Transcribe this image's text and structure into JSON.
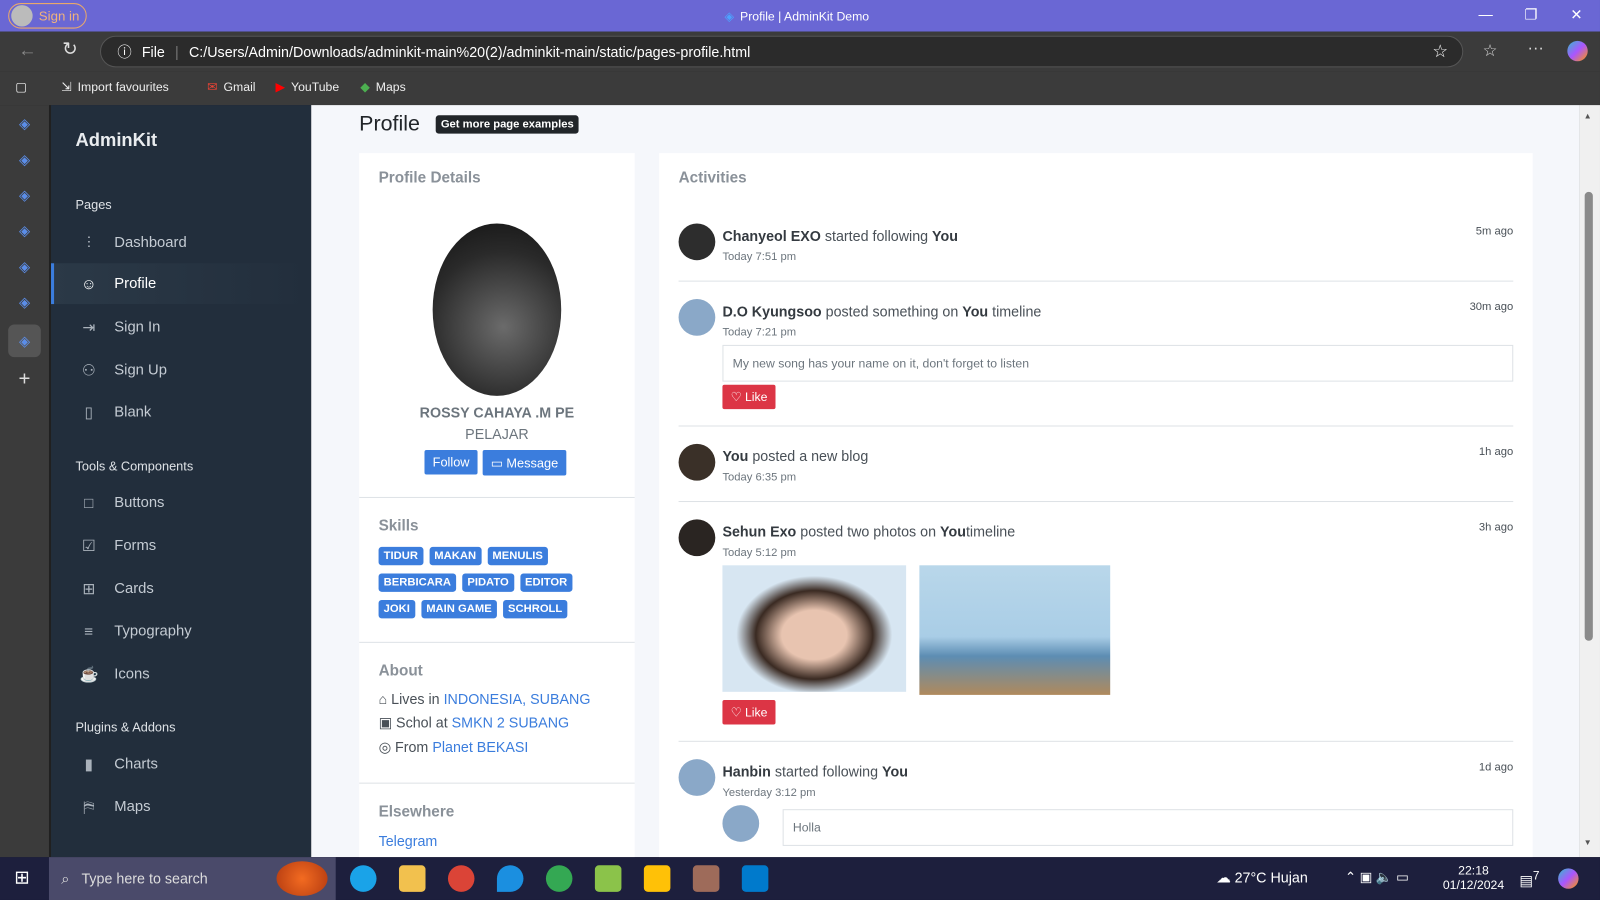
{
  "browser": {
    "signin": "Sign in",
    "title": "Profile | AdminKit Demo",
    "file_label": "File",
    "url": "C:/Users/Admin/Downloads/adminkit-main%20(2)/adminkit-main/static/pages-profile.html",
    "bookmarks": [
      "Import favourites",
      "Gmail",
      "YouTube",
      "Maps"
    ]
  },
  "sidebar": {
    "brand": "AdminKit",
    "sections": [
      "Pages",
      "Tools & Components",
      "Plugins & Addons"
    ],
    "items": [
      {
        "label": "Dashboard",
        "icon": "sliders-icon"
      },
      {
        "label": "Profile",
        "icon": "user-icon"
      },
      {
        "label": "Sign In",
        "icon": "log-in-icon"
      },
      {
        "label": "Sign Up",
        "icon": "user-plus-icon"
      },
      {
        "label": "Blank",
        "icon": "book-icon"
      },
      {
        "label": "Buttons",
        "icon": "square-icon"
      },
      {
        "label": "Forms",
        "icon": "check-square-icon"
      },
      {
        "label": "Cards",
        "icon": "grid-icon"
      },
      {
        "label": "Typography",
        "icon": "align-left-icon"
      },
      {
        "label": "Icons",
        "icon": "coffee-icon"
      },
      {
        "label": "Charts",
        "icon": "bar-chart-icon"
      },
      {
        "label": "Maps",
        "icon": "map-icon"
      }
    ]
  },
  "page": {
    "title": "Profile",
    "badge": "Get more page examples"
  },
  "profile": {
    "card_title": "Profile Details",
    "name": "ROSSY CAHAYA .M PE",
    "role": "PELAJAR",
    "follow": "Follow",
    "message": "Message",
    "skills_title": "Skills",
    "skills": [
      "TIDUR",
      "MAKAN",
      "MENULIS",
      "BERBICARA",
      "PIDATO",
      "EDITOR",
      "JOKI",
      "MAIN GAME",
      "SCHROLL"
    ],
    "about_title": "About",
    "about": [
      {
        "prefix": "Lives in",
        "link": "INDONESIA, SUBANG"
      },
      {
        "prefix": "Schol at",
        "link": "SMKN 2 SUBANG"
      },
      {
        "prefix": "From",
        "link": "Planet BEKASI"
      }
    ],
    "elsewhere_title": "Elsewhere",
    "elsewhere": [
      "Telegram"
    ]
  },
  "activities": {
    "title": "Activities",
    "like": "Like",
    "items": [
      {
        "who": "Chanyeol EXO",
        "action": "started following",
        "target": "You",
        "rest": "",
        "time": "Today 7:51 pm",
        "ago": "5m ago"
      },
      {
        "who": "D.O Kyungsoo",
        "action": "posted something on",
        "target": "You",
        "rest": "timeline",
        "time": "Today 7:21 pm",
        "ago": "30m ago",
        "quote": "My new song has your name on it, don't forget to listen"
      },
      {
        "who": "You",
        "action": "posted a new blog",
        "target": "",
        "rest": "",
        "time": "Today 6:35 pm",
        "ago": "1h ago"
      },
      {
        "who": "Sehun Exo",
        "action": "posted two photos on",
        "target": "You",
        "rest": "timeline",
        "time": "Today 5:12 pm",
        "ago": "3h ago"
      },
      {
        "who": "Hanbin",
        "action": "started following",
        "target": "You",
        "rest": "",
        "time": "Yesterday 3:12 pm",
        "ago": "1d ago",
        "quote": "Holla"
      }
    ]
  },
  "taskbar": {
    "search": "Type here to search",
    "weather": "27°C  Hujan",
    "time": "22:18",
    "date": "01/12/2024",
    "notif": "7"
  }
}
